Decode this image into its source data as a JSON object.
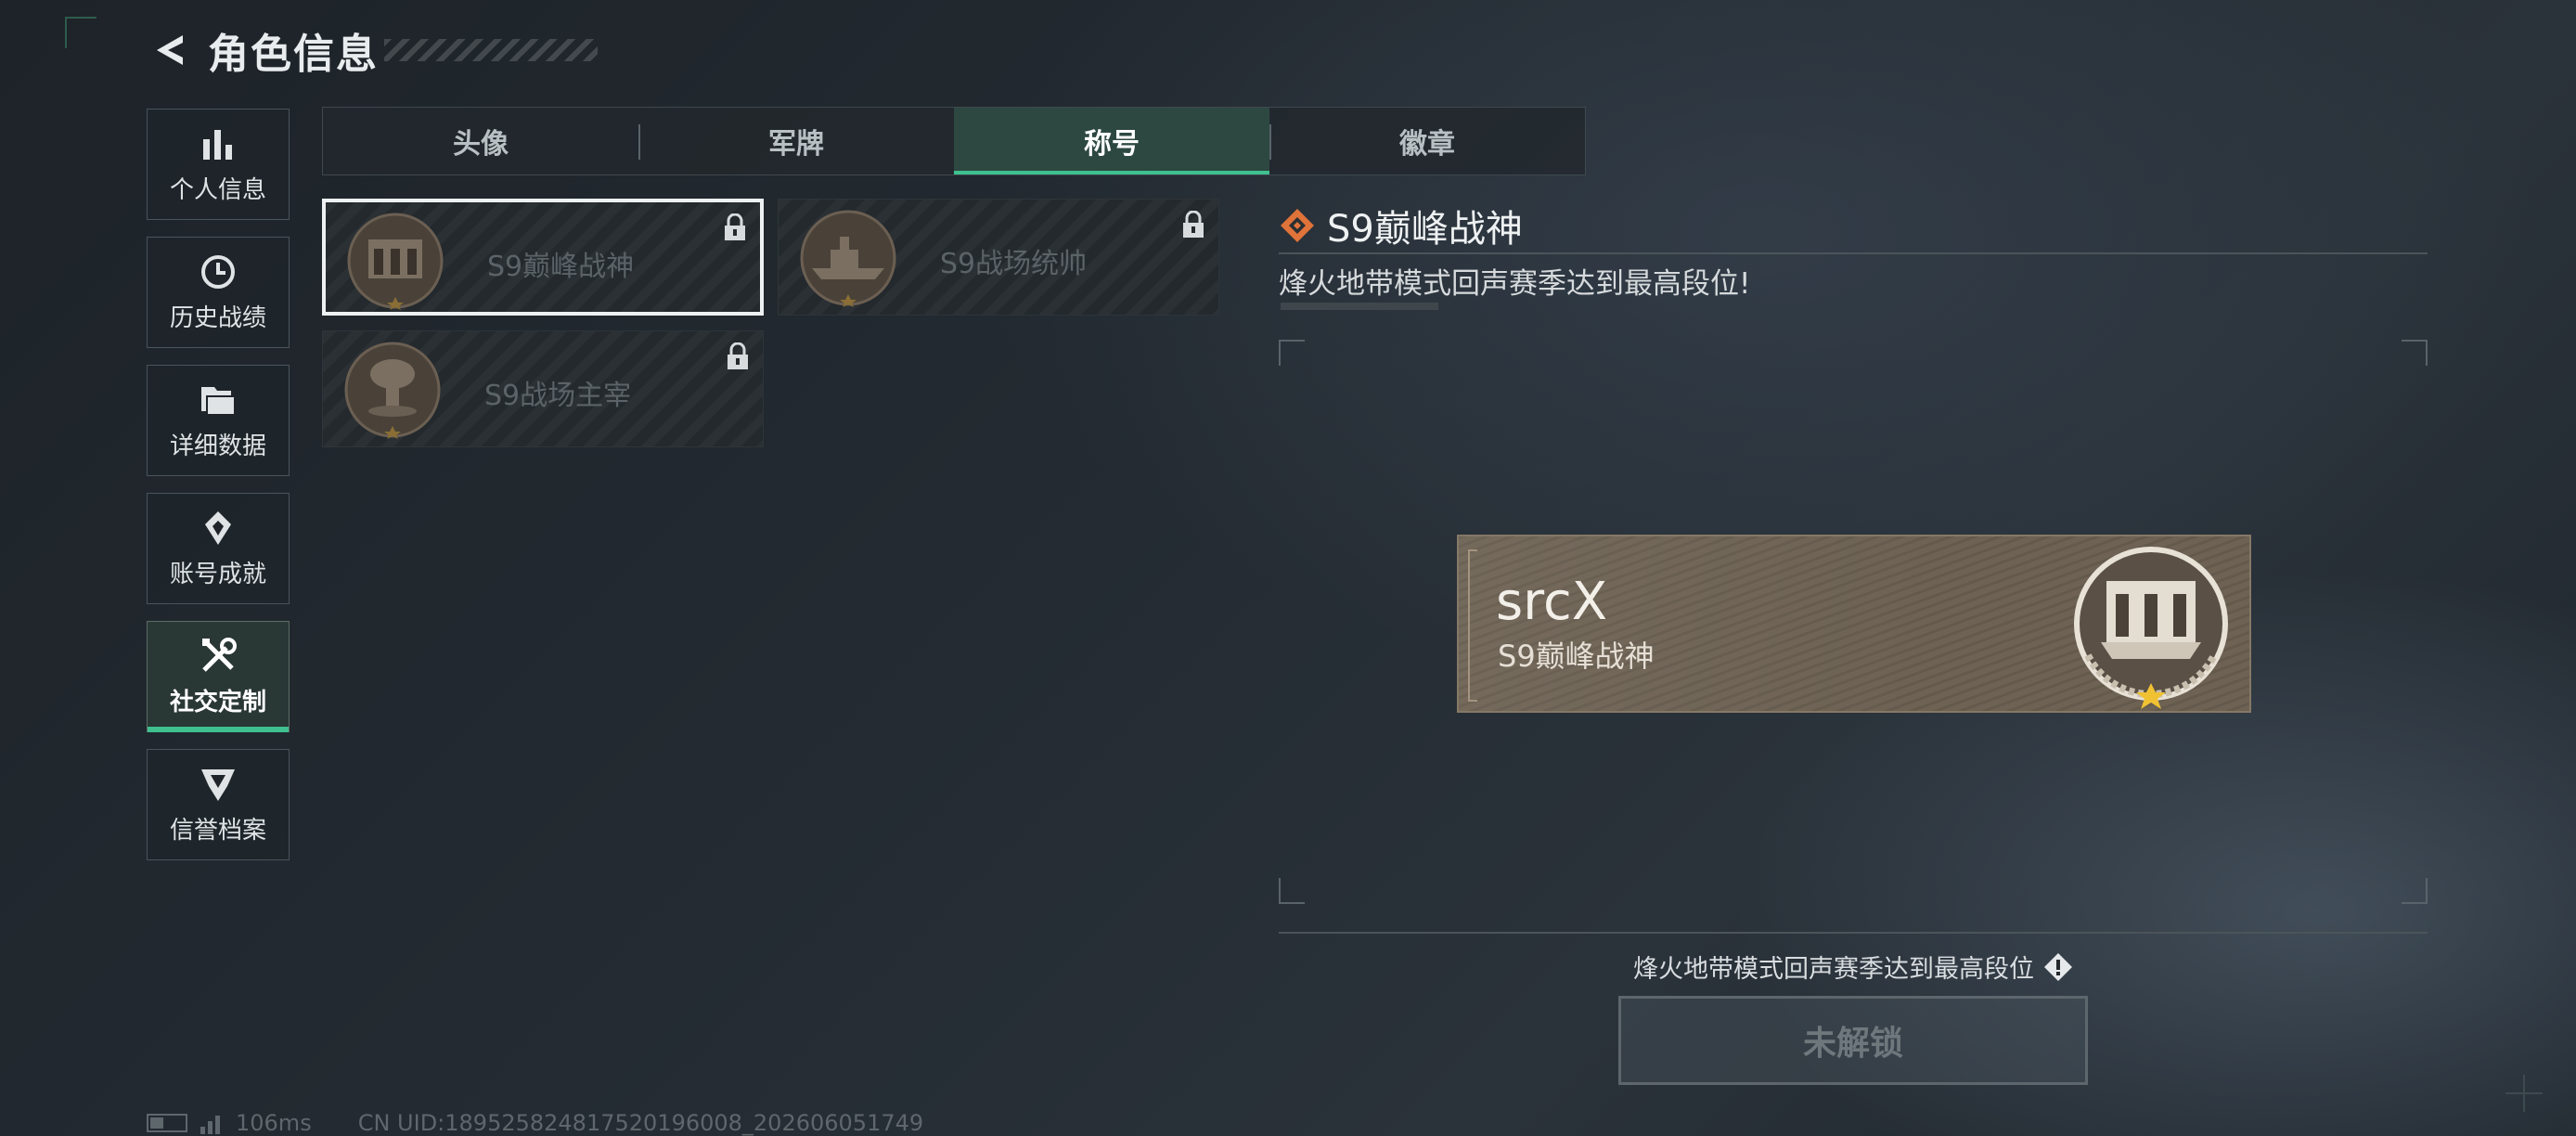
{
  "header": {
    "title": "角色信息",
    "back_icon": "back-arrow-icon"
  },
  "sidebar": {
    "items": [
      {
        "label": "个人信息",
        "icon": "bar-chart-icon",
        "active": false
      },
      {
        "label": "历史战绩",
        "icon": "history-clock-icon",
        "active": false
      },
      {
        "label": "详细数据",
        "icon": "folder-icon",
        "active": false
      },
      {
        "label": "账号成就",
        "icon": "achievement-icon",
        "active": false
      },
      {
        "label": "社交定制",
        "icon": "tools-icon",
        "active": true
      },
      {
        "label": "信誉档案",
        "icon": "credit-shield-icon",
        "active": false
      }
    ]
  },
  "tabs": [
    {
      "label": "头像",
      "active": false
    },
    {
      "label": "军牌",
      "active": false
    },
    {
      "label": "称号",
      "active": true
    },
    {
      "label": "徽章",
      "active": false
    }
  ],
  "titles": [
    {
      "name": "S9巅峰战神",
      "icon": "fortress-emblem-icon",
      "locked": true,
      "selected": true
    },
    {
      "name": "S9战场统帅",
      "icon": "warship-emblem-icon",
      "locked": true,
      "selected": false
    },
    {
      "name": "S9战场主宰",
      "icon": "mushroom-cloud-emblem-icon",
      "locked": true,
      "selected": false
    }
  ],
  "detail": {
    "title": "S9巅峰战神",
    "description": "烽火地带模式回声赛季达到最高段位!",
    "nameplate": {
      "player": "srcX",
      "title": "S9巅峰战神"
    },
    "unlock_condition": "烽火地带模式回声赛季达到最高段位",
    "unlock_button": "未解锁"
  },
  "status": {
    "ping": "106ms",
    "uid": "CN UID:18952582481752019600​8_202606051749"
  },
  "colors": {
    "accent": "#3fc08f",
    "title_icon": "#e0733a",
    "nameplate_bg": "#6d6253"
  }
}
